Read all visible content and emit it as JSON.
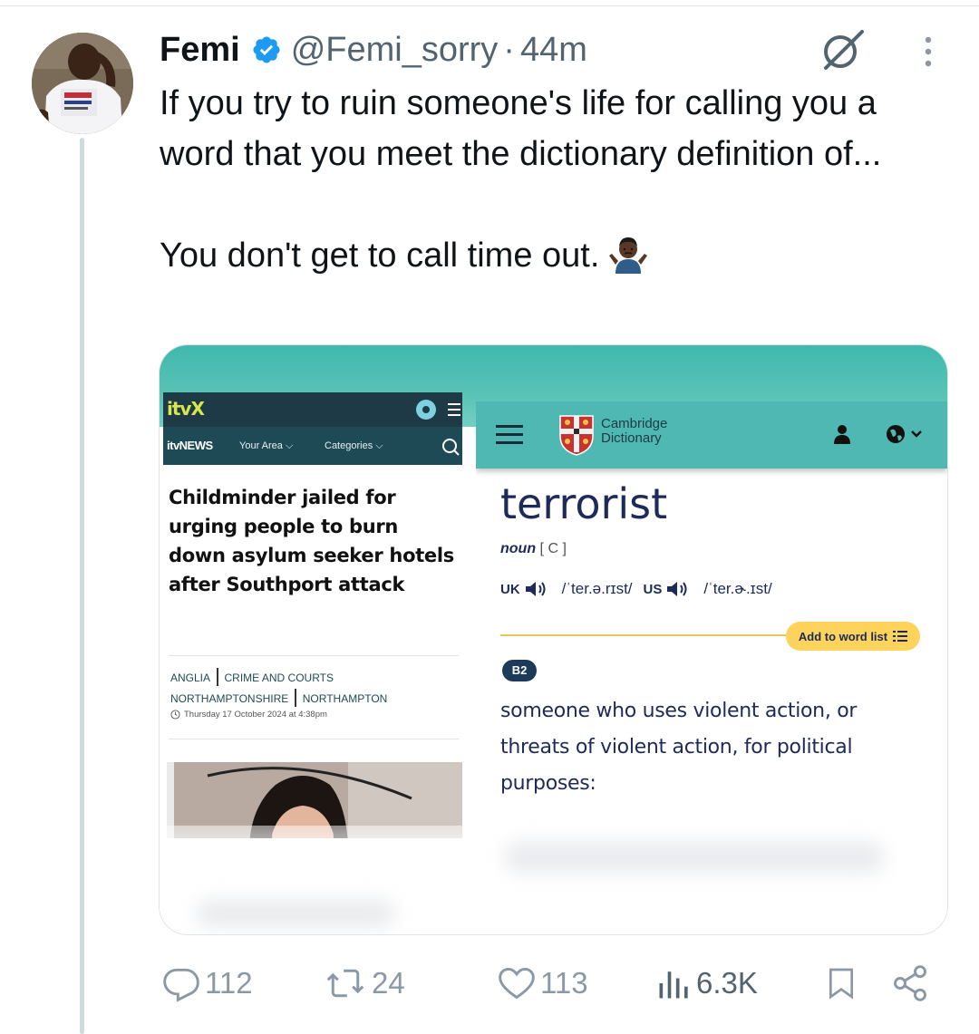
{
  "tweet": {
    "author_name": "Femi",
    "handle": "@Femi_sorry",
    "separator": "·",
    "time": "44m",
    "text_lines": [
      "If you try to ruin someone's life for calling you a word that you meet the dictionary definition of...",
      "You don't get to call time out."
    ],
    "emoji": "person-shrugging-emoji"
  },
  "media": {
    "itv": {
      "logo": "itvX",
      "news_logo": "itvNEWS",
      "nav_items": [
        "Your Area ⌵",
        "Categories ⌵"
      ],
      "headline": "Childminder jailed for urging people to burn down asylum seeker hotels after Southport attack",
      "tags": [
        [
          "ANGLIA",
          "CRIME AND COURTS"
        ],
        [
          "NORTHAMPTONSHIRE",
          "NORTHAMPTON"
        ]
      ],
      "date": "Thursday 17 October 2024 at 4:38pm"
    },
    "cambridge": {
      "brand_line1": "Cambridge",
      "brand_line2": "Dictionary",
      "word": "terrorist",
      "part_of_speech": "noun",
      "grammar_code": "[ C ]",
      "uk_label": "UK",
      "uk_ipa": "/ˈter.ə.rɪst/",
      "us_label": "US",
      "us_ipa": "/ˈter.ɚ.ɪst/",
      "add_to_list": "Add to word list",
      "level": "B2",
      "definition": "someone who uses violent action, or threats of violent action, for political purposes:"
    }
  },
  "actions": {
    "replies": "112",
    "reposts": "24",
    "likes": "113",
    "views": "6.3K"
  },
  "colors": {
    "text": "#0f1419",
    "secondary": "#536471",
    "verified": "#1d9bf0",
    "thread_line": "#cfd9de",
    "teal": "#4fb8b2"
  }
}
